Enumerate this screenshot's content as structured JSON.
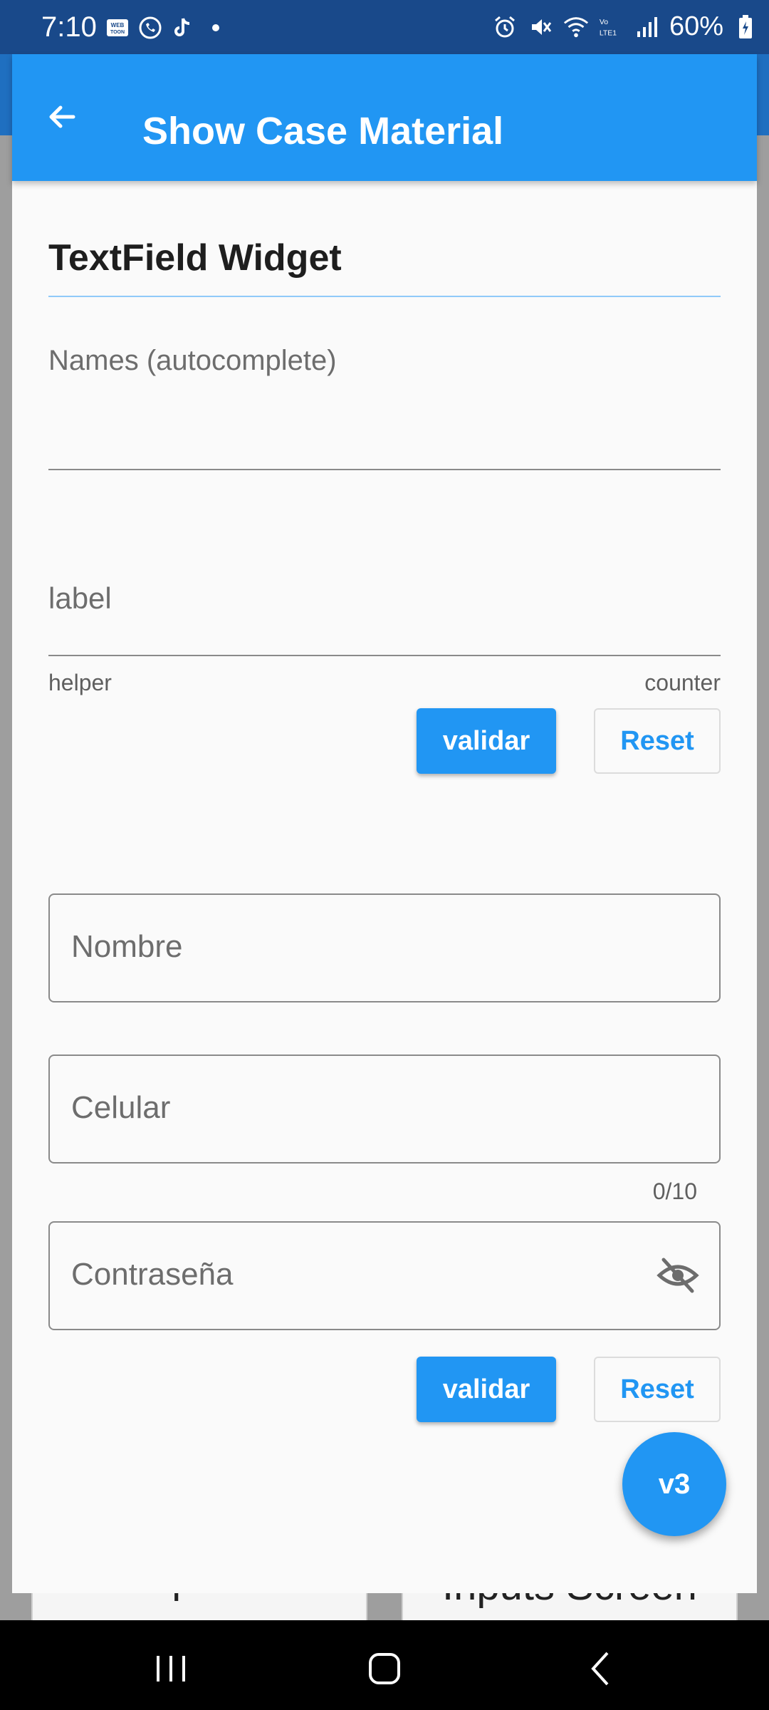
{
  "status_bar": {
    "time": "7:10",
    "battery": "60%",
    "left_icons": [
      "webtoon-icon",
      "whatsapp-icon",
      "tiktok-icon",
      "notification-dot"
    ],
    "right_icons": [
      "alarm-icon",
      "mute-icon",
      "wifi-icon",
      "volte-icon",
      "signal-icon",
      "battery-icon"
    ]
  },
  "background_cards": [
    "Dropdown",
    "Inputs Screen"
  ],
  "app_bar": {
    "title": "Show Case Material",
    "back_icon": "arrow-back-icon",
    "color": "#2196f3"
  },
  "main": {
    "section_title": "TextField Widget",
    "autocomplete_label": "Names (autocomplete)",
    "labeled_field": {
      "label": "label",
      "helper": "helper",
      "counter": "counter"
    },
    "buttons_row1": {
      "validate": "validar",
      "reset": "Reset"
    },
    "fields": {
      "nombre_placeholder": "Nombre",
      "celular_placeholder": "Celular",
      "celular_counter": "0/10",
      "password_placeholder": "Contraseña",
      "password_toggle_icon": "visibility-off-icon"
    },
    "buttons_row2": {
      "validate": "validar",
      "reset": "Reset"
    }
  },
  "fab": {
    "label": "v3"
  },
  "nav_bar": {
    "icons": [
      "recent-apps-icon",
      "home-icon",
      "back-icon"
    ]
  }
}
